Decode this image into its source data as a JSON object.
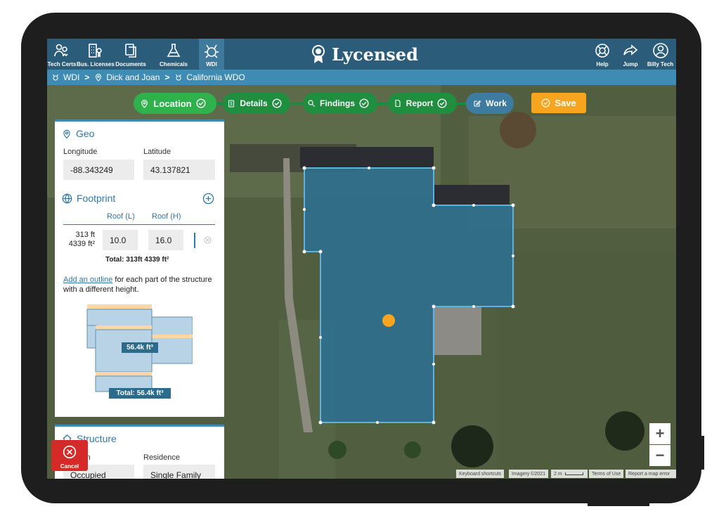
{
  "nav": {
    "items": [
      {
        "label": "Tech Certs",
        "icon": "people-badge-icon"
      },
      {
        "label": "Bus. Licenses",
        "icon": "building-icon"
      },
      {
        "label": "Documents",
        "icon": "documents-icon"
      },
      {
        "label": "Chemicals",
        "icon": "flask-icon"
      },
      {
        "label": "WDI",
        "icon": "termite-icon"
      }
    ],
    "active": "WDI",
    "brand": "Lycensed",
    "right_items": [
      {
        "label": "Help",
        "icon": "lifebuoy-icon"
      },
      {
        "label": "Jump",
        "icon": "share-arrow-icon"
      },
      {
        "label": "Billy Tech",
        "icon": "user-circle-icon"
      }
    ]
  },
  "breadcrumb": [
    "WDI",
    "Dick and Joan",
    "California WDO"
  ],
  "steps": [
    "Location",
    "Details",
    "Findings",
    "Report",
    "Work"
  ],
  "save_label": "Save",
  "geo": {
    "title": "Geo",
    "longitude_label": "Longitude",
    "latitude_label": "Latitude",
    "longitude": "-88.343249",
    "latitude": "43.137821"
  },
  "footprint": {
    "title": "Footprint",
    "col_low": "Roof (L)",
    "col_high": "Roof (H)",
    "rows": [
      {
        "perimeter": "313 ft",
        "area": "4339 ft²",
        "roof_low": "10.0",
        "roof_high": "16.0"
      }
    ],
    "total": "Total:  313ft  4339 ft²",
    "help_link": "Add an outline",
    "help_text": " for each part of the structure with a different height.",
    "diagram_label": "56.4k ft³",
    "diagram_total": "Total: 56.4k ft³"
  },
  "structure": {
    "title": "Structure",
    "field1_label": "ion",
    "field2_label": "Residence",
    "field1_value": "Occupied",
    "field2_value": "Single Family"
  },
  "cancel_label": "Cancel",
  "map": {
    "zoom_in": "+",
    "zoom_out": "−",
    "attribution": [
      "Keyboard shortcuts",
      "Imagery ©2021",
      "2 m",
      "Terms of Use",
      "Report a map error"
    ]
  },
  "colors": {
    "header": "#2b5d7b",
    "breadcrumb": "#3e8bb3",
    "step_done": "#1f8f3f",
    "save": "#f7a51e",
    "cancel": "#d42a28",
    "footprint_fill": "#2e6f8e"
  }
}
